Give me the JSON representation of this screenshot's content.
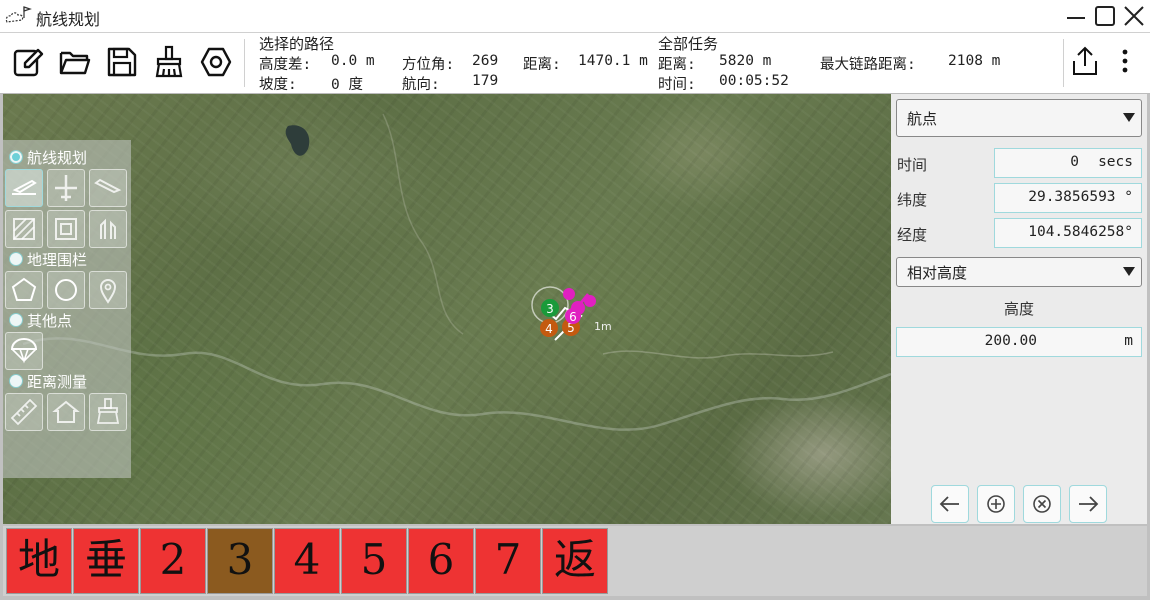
{
  "window": {
    "title": "航线规划"
  },
  "toolbar": {
    "icons": [
      "edit-icon",
      "open-folder-icon",
      "save-icon",
      "clear-brush-icon",
      "settings-hex-icon"
    ],
    "right_icons": [
      "upload-icon",
      "more-vert-icon"
    ]
  },
  "selected_path": {
    "header": "选择的路径",
    "alt_diff_label": "高度差:",
    "alt_diff_value": "0.0 m",
    "azimuth_label": "方位角:",
    "azimuth_value": "269",
    "distance_label": "距离:",
    "distance_value": "1470.1 m",
    "slope_label": "坡度:",
    "slope_value": "0 度",
    "heading_label": "航向:",
    "heading_value": "179"
  },
  "total_mission": {
    "header": "全部任务",
    "distance_label": "距离:",
    "distance_value": "5820 m",
    "max_link_label": "最大链路距离:",
    "max_link_value": "2108 m",
    "time_label": "时间:",
    "time_value": "00:05:52"
  },
  "left_panel": {
    "route_planning": {
      "label": "航线规划",
      "checked": true,
      "tools": [
        "takeoff-icon",
        "plane-icon",
        "land-icon",
        "survey-grid-icon",
        "structure-scan-icon",
        "corridor-icon"
      ]
    },
    "geofence": {
      "label": "地理围栏",
      "checked": false,
      "tools": [
        "polygon-icon",
        "circle-icon",
        "pin-icon"
      ]
    },
    "other_points": {
      "label": "其他点",
      "checked": false,
      "tools": [
        "parachute-icon"
      ]
    },
    "distance_measure": {
      "label": "距离测量",
      "checked": false,
      "tools": [
        "ruler-icon",
        "area-house-icon",
        "clear-brush-icon"
      ]
    }
  },
  "map": {
    "markers": [
      {
        "label": "3",
        "color": "#1a9a3a"
      },
      {
        "label": "4",
        "color": "#c45a10"
      },
      {
        "label": "5",
        "color": "#c45a10"
      },
      {
        "label": "6",
        "color": "#e020c0"
      }
    ],
    "scale_label": "1m"
  },
  "right_panel": {
    "type_select": "航点",
    "time_label": "时间",
    "time_value": "0",
    "time_unit": "secs",
    "lat_label": "纬度",
    "lat_value": "29.3856593 °",
    "lon_label": "经度",
    "lon_value": "104.5846258°",
    "alt_mode_select": "相对高度",
    "altitude_label": "高度",
    "altitude_value": "200.00",
    "altitude_unit": "m",
    "nav_icons": [
      "arrow-left-icon",
      "add-circle-icon",
      "delete-circle-icon",
      "arrow-right-icon"
    ]
  },
  "steps": [
    {
      "label": "地",
      "active": false
    },
    {
      "label": "垂",
      "active": false
    },
    {
      "label": "2",
      "active": false
    },
    {
      "label": "3",
      "active": true
    },
    {
      "label": "4",
      "active": false
    },
    {
      "label": "5",
      "active": false
    },
    {
      "label": "6",
      "active": false
    },
    {
      "label": "7",
      "active": false
    },
    {
      "label": "返",
      "active": false
    }
  ],
  "colors": {
    "accent": "#9fd9dd",
    "step_red": "#ee3333",
    "step_active": "#8b5a1f"
  }
}
